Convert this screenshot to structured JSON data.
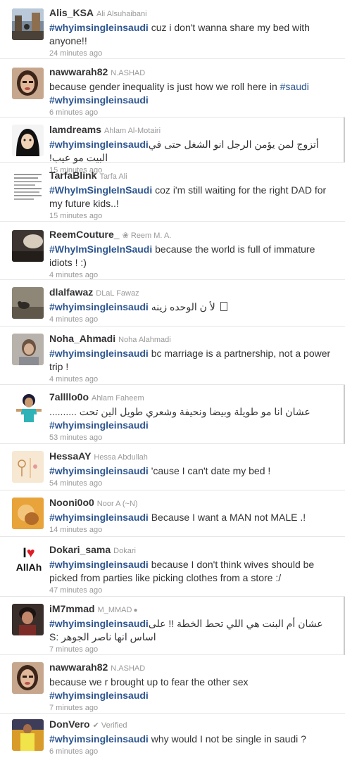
{
  "tweets": [
    {
      "handle": "Alis_KSA",
      "name": "Ali Alsuhaibani",
      "tag": "#whyimsingleinsaudi",
      "text": " cuz i don't wanna share my bed with anyone!!",
      "time": "24 minutes ago",
      "avatar": "street-scene-avatar"
    },
    {
      "handle": "nawwarah82",
      "name": "N.ASHAD",
      "pre": "because gender inequality is just how we roll here in ",
      "link": "#saudi",
      "tag": "#whyimsingleinsaudi",
      "time": "6 minutes ago",
      "avatar": "woman-portrait-avatar"
    },
    {
      "handle": "lamdreams",
      "name": "Ahlam Al-Motairi",
      "tag": "#whyimsingleinsaudi",
      "text": " أتزوج لمن يؤمن الرجل انو الشغل حتى في البيت مو عيب!",
      "time": "15 minutes ago",
      "avatar": "hijab-cartoon-avatar"
    },
    {
      "handle": "TarfaBlink",
      "name": "Tarfa Ali",
      "tag": "#WhyImSingleInSaudi",
      "text": " coz i'm still waiting for the right DAD for my future kids..!",
      "time": "15 minutes ago",
      "avatar": "document-avatar"
    },
    {
      "handle": "ReemCouture_",
      "name": "Reem M. A.",
      "tag": "#WhyImSingleInSaudi",
      "text": " because the world is full of immature idiots ! :)",
      "time": "4 minutes ago",
      "avatar": "dark-room-avatar"
    },
    {
      "handle": "dlalfawaz",
      "name": "DLaL Fawaz",
      "tag": "#whyimsingleinsaudi",
      "text": " لأ ن الوحده زينه ",
      "time": "4 minutes ago",
      "avatar": "bird-avatar"
    },
    {
      "handle": "Noha_Ahmadi",
      "name": "Noha Alahmadi",
      "tag": "#whyimsingleinsaudi",
      "text": " bc marriage is a partnership, not a power trip !",
      "time": "4 minutes ago",
      "avatar": "person-photo-avatar"
    },
    {
      "handle": "7allllo0o",
      "name": "Ahlam Faheem",
      "text": "عشان انا مو طويلة وبيضا ونحيفة وشعري طويل الين تحت ..........",
      "tag": "#whyimsingleinsaudi",
      "time": "53 minutes ago",
      "avatar": "princess-cartoon-avatar"
    },
    {
      "handle": "HessaAY",
      "name": "Hessa Abdullah",
      "tag": "#whyimsingleinsaudi",
      "text": " 'cause I can't date my bed !",
      "time": "54 minutes ago",
      "avatar": "sketch-avatar"
    },
    {
      "handle": "Nooni0o0",
      "name": "Noor A (~N)",
      "tag": "#whyimsingleinsaudi",
      "text": " Because I want a MAN not MALE .!",
      "time": "14 minutes ago",
      "avatar": "orange-photo-avatar"
    },
    {
      "handle": "Dokari_sama",
      "name": "Dokari",
      "tag": "#whyimsingleinsaudi",
      "text": " because I don't think wives should be picked from parties like picking clothes from a store :/",
      "time": "47 minutes ago",
      "avatar": "i-love-allah-avatar",
      "logo_top": "I",
      "logo_bottom": "AllAh"
    },
    {
      "handle": "iM7mmad",
      "name": "M_MMAD",
      "tag": "#whyimsingleinsaudi",
      "text": " عشان أم البنت هي اللي تحط الخطة !! على اساس انها ناصر الجوهر :S",
      "time": "7 minutes ago",
      "avatar": "cartoon-boy-avatar"
    },
    {
      "handle": "nawwarah82",
      "name": "N.ASHAD",
      "pre": "because we r brought up to fear the other sex",
      "tag": "#whyimsingleinsaudi",
      "time": "7 minutes ago",
      "avatar": "woman-portrait-avatar"
    },
    {
      "handle": "DonVero",
      "name": "Verified",
      "tag": "#whyimsingleinsaudi",
      "text": " why would I not be single in saudi ?",
      "time": "6 minutes ago",
      "avatar": "football-player-avatar"
    }
  ]
}
